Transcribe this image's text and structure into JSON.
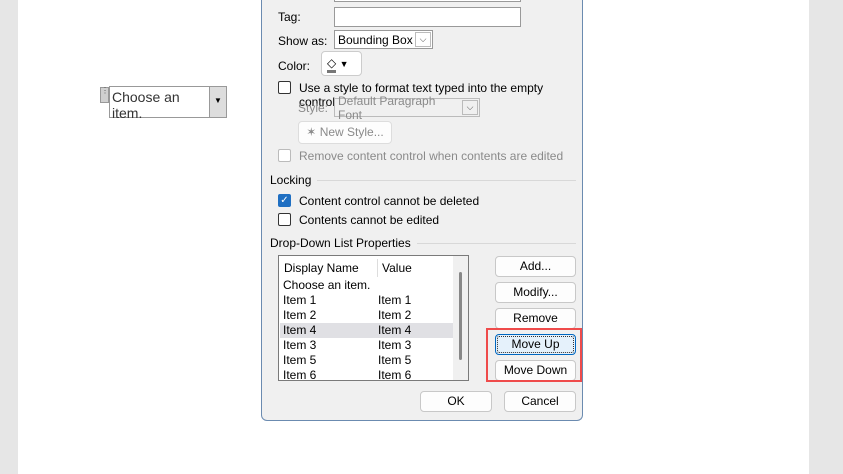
{
  "document": {
    "control_text": "Choose an item."
  },
  "dialog": {
    "tag_label": "Tag:",
    "tag_value": "",
    "show_as_label": "Show as:",
    "show_as_value": "Bounding Box",
    "color_label": "Color:",
    "use_style_label": "Use a style to format text typed into the empty control",
    "style_label": "Style:",
    "style_value": "Default Paragraph Font",
    "new_style_label": "New Style...",
    "remove_cc_label": "Remove content control when contents are edited",
    "locking_label": "Locking",
    "cannot_delete_label": "Content control cannot be deleted",
    "cannot_edit_label": "Contents cannot be edited",
    "dropdown_props_label": "Drop-Down List Properties",
    "list": {
      "headers": [
        "Display Name",
        "Value"
      ],
      "rows": [
        [
          "Choose an item.",
          ""
        ],
        [
          "Item 1",
          "Item 1"
        ],
        [
          "Item 2",
          "Item 2"
        ],
        [
          "Item 4",
          "Item 4"
        ],
        [
          "Item 3",
          "Item 3"
        ],
        [
          "Item 5",
          "Item 5"
        ],
        [
          "Item 6",
          "Item 6"
        ]
      ]
    },
    "buttons": {
      "add": "Add...",
      "modify": "Modify...",
      "remove": "Remove",
      "move_up": "Move Up",
      "move_down": "Move Down",
      "ok": "OK",
      "cancel": "Cancel"
    }
  },
  "colors": {
    "highlight": "#ef4b4b",
    "check": "#1f6fc2"
  }
}
